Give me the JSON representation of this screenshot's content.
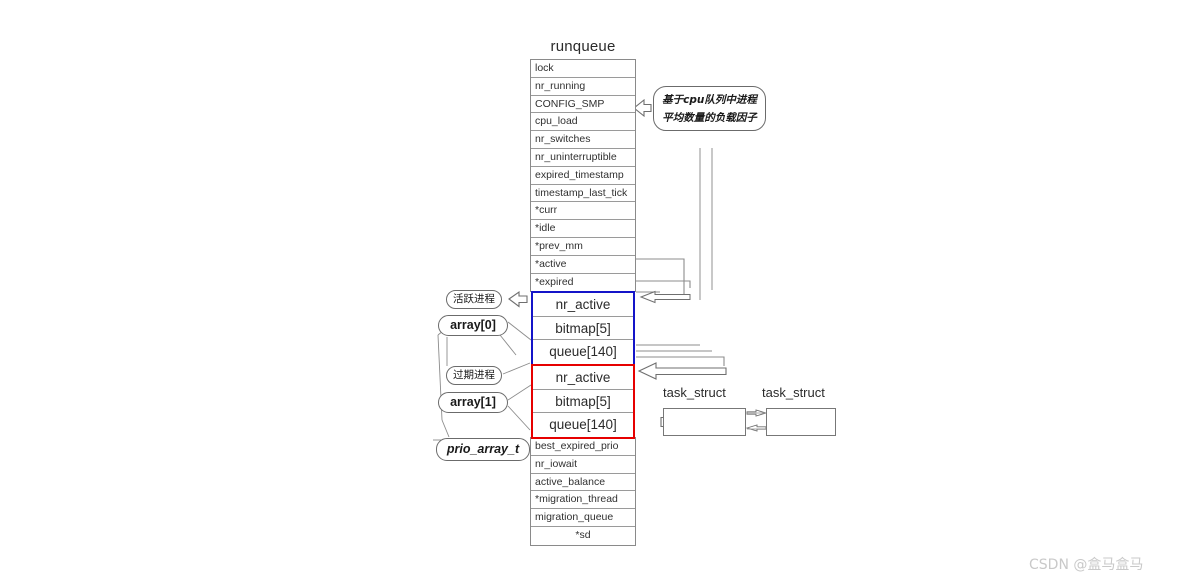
{
  "diagram": {
    "struct_title": "runqueue",
    "fields_top": [
      "lock",
      "nr_running",
      "CONFIG_SMP",
      "cpu_load",
      "nr_switches",
      "nr_uninterruptible",
      "expired_timestamp",
      "timestamp_last_tick",
      "*curr",
      "*idle",
      "*prev_mm",
      "*active",
      "*expired"
    ],
    "fields_bottom": [
      "best_expired_prio",
      "nr_iowait",
      "active_balance",
      "*migration_thread",
      "migration_queue",
      "*sd"
    ],
    "prio_array_active": {
      "border_color": "#1414c8",
      "rows": [
        "nr_active",
        "bitmap[5]",
        "queue[140]"
      ]
    },
    "prio_array_expired": {
      "border_color": "#e60000",
      "rows": [
        "nr_active",
        "bitmap[5]",
        "queue[140]"
      ]
    },
    "callouts": {
      "load_factor_line1": "基于cpu队列中进程",
      "load_factor_line2": "平均数量的负载因子",
      "active_processes": "活跃进程",
      "expired_processes": "过期进程",
      "array0": "array[0]",
      "array1": "array[1]",
      "prio_array_type": "prio_array_t"
    },
    "task_structs": {
      "label_1": "task_struct",
      "label_2": "task_struct"
    },
    "watermark": "CSDN @盒马盒马"
  }
}
